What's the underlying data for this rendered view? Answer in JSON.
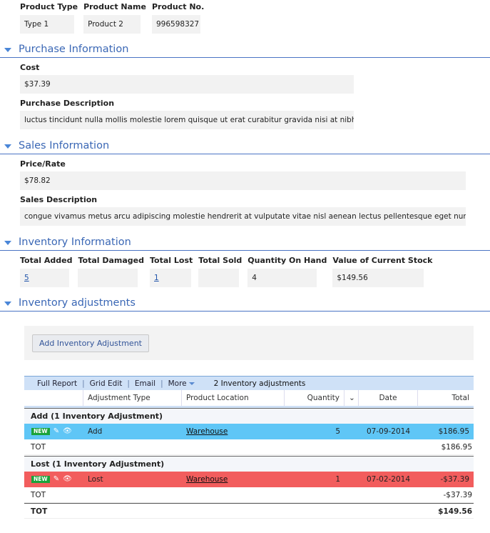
{
  "top": {
    "product_type": {
      "label": "Product Type",
      "value": "Type 1"
    },
    "product_name": {
      "label": "Product Name",
      "value": "Product 2"
    },
    "product_no": {
      "label": "Product No.",
      "value": "996598327"
    }
  },
  "sections": {
    "purchase": "Purchase Information",
    "sales": "Sales Information",
    "inventory": "Inventory Information",
    "adjustments": "Inventory adjustments"
  },
  "purchase": {
    "cost_label": "Cost",
    "cost_value": "$37.39",
    "desc_label": "Purchase Description",
    "desc_value": "luctus tincidunt nulla mollis molestie lorem quisque ut erat curabitur gravida nisi at nibh in hac"
  },
  "sales": {
    "price_label": "Price/Rate",
    "price_value": "$78.82",
    "desc_label": "Sales Description",
    "desc_value": "congue vivamus metus arcu adipiscing molestie hendrerit at vulputate vitae nisl aenean lectus pellentesque eget nunc donec"
  },
  "inventory": {
    "total_added": {
      "label": "Total Added",
      "value": "5"
    },
    "total_damaged": {
      "label": "Total Damaged",
      "value": ""
    },
    "total_lost": {
      "label": "Total Lost",
      "value": "1"
    },
    "total_sold": {
      "label": "Total Sold",
      "value": ""
    },
    "qty_on_hand": {
      "label": "Quantity On Hand",
      "value": "4"
    },
    "stock_value": {
      "label": "Value of Current Stock",
      "value": "$149.56"
    }
  },
  "adjust": {
    "add_button": "Add  Inventory Adjustment",
    "toolbar": {
      "full_report": "Full Report",
      "grid_edit": "Grid Edit",
      "email": "Email",
      "more": "More",
      "count": "2 Inventory adjustments"
    },
    "columns": {
      "adj_type": "Adjustment Type",
      "location": "Product Location",
      "quantity": "Quantity",
      "date": "Date",
      "total": "Total"
    },
    "groups": [
      {
        "header": "Add  (1 Inventory Adjustment)",
        "badge": "NEW",
        "type": "Add",
        "location": "Warehouse",
        "quantity": "5",
        "date": "07-09-2014",
        "total": "$186.95",
        "tot_label": "TOT",
        "tot_value": "$186.95"
      },
      {
        "header": "Lost  (1 Inventory Adjustment)",
        "badge": "NEW",
        "type": "Lost",
        "location": "Warehouse",
        "quantity": "1",
        "date": "07-02-2014",
        "total": "-$37.39",
        "tot_label": "TOT",
        "tot_value": "-$37.39"
      }
    ],
    "grand_label": "TOT",
    "grand_value": "$149.56"
  },
  "colors": {
    "accent": "#3a67b5",
    "add_row": "#5fc6f6",
    "lost_row": "#f25d5d",
    "badge": "#1aa33a"
  }
}
